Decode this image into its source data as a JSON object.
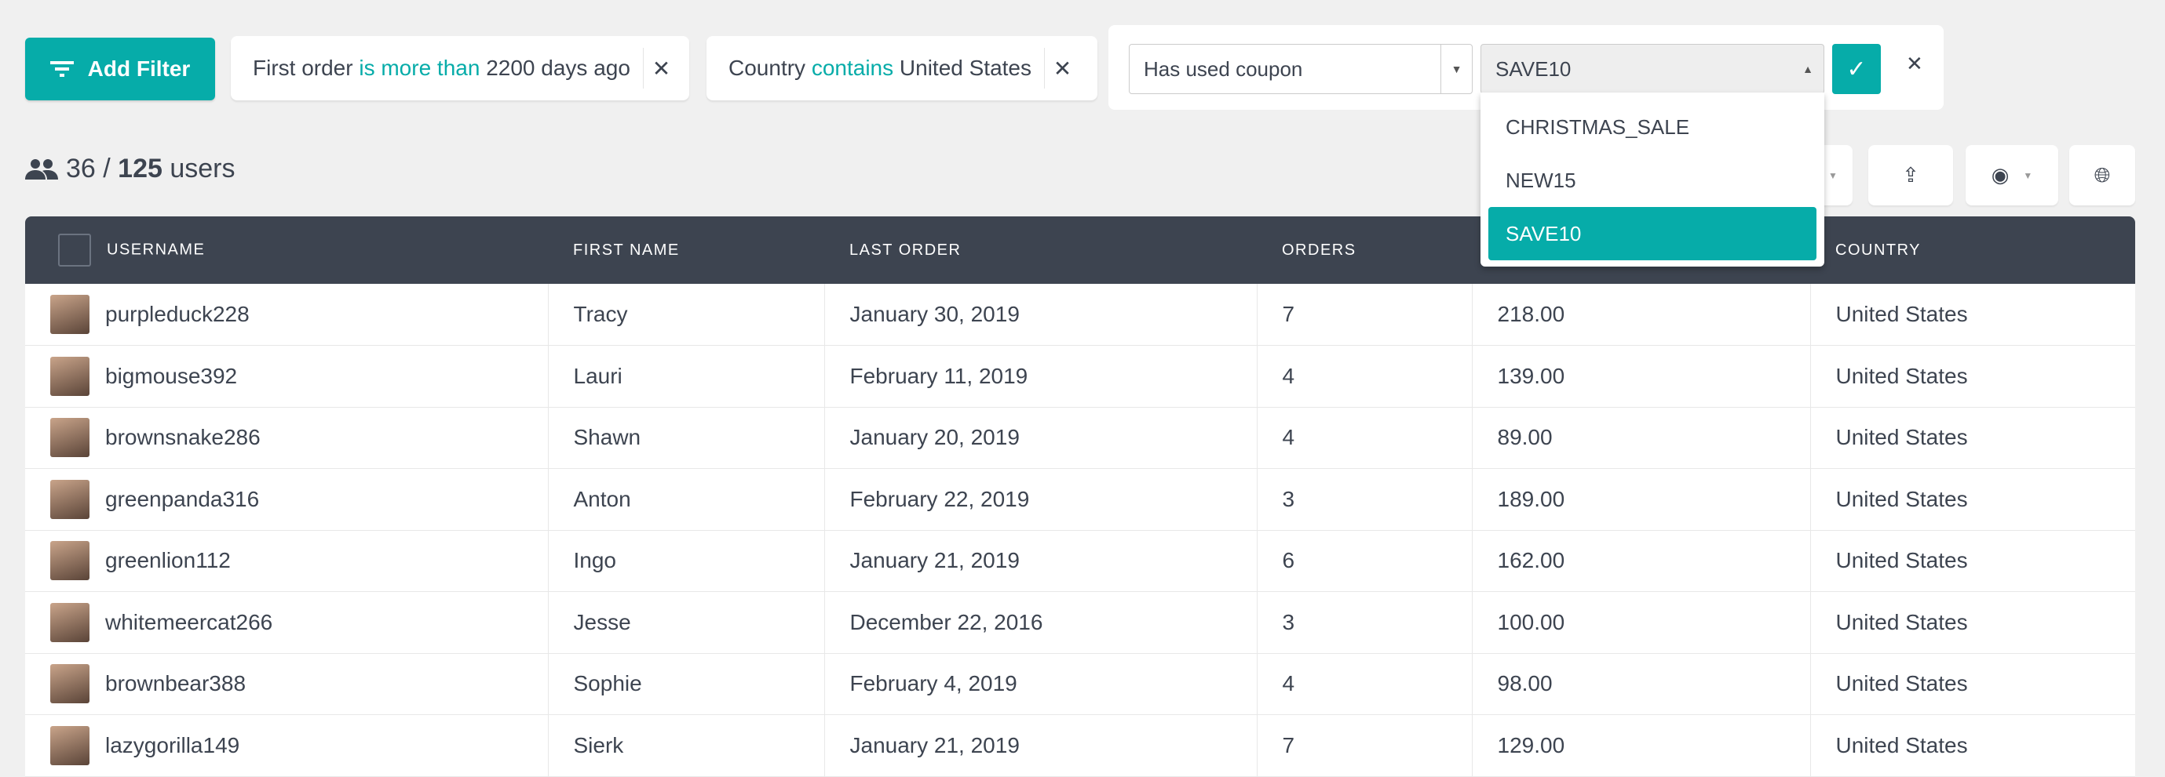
{
  "add_filter": {
    "label": "Add Filter",
    "icon": "filter-icon"
  },
  "filters": [
    {
      "field": "First order",
      "op": "is more than",
      "value": "2200 days ago"
    },
    {
      "field": "Country",
      "op": "contains",
      "value": "United States"
    }
  ],
  "editor": {
    "field": "Has used coupon",
    "value": "SAVE10",
    "options": [
      "CHRISTMAS_SALE",
      "NEW15",
      "SAVE10"
    ],
    "selected": "SAVE10"
  },
  "count": {
    "shown": "36",
    "sep": " / ",
    "total": "125",
    "unit": " users"
  },
  "accent": "#06aca9",
  "header_color": "#3d4450",
  "columns": [
    "USERNAME",
    "FIRST NAME",
    "LAST ORDER",
    "ORDERS",
    "",
    "COUNTRY"
  ],
  "rows": [
    [
      "purpleduck228",
      "Tracy",
      "January 30, 2019",
      "7",
      "218.00",
      "United States"
    ],
    [
      "bigmouse392",
      "Lauri",
      "February 11, 2019",
      "4",
      "139.00",
      "United States"
    ],
    [
      "brownsnake286",
      "Shawn",
      "January 20, 2019",
      "4",
      "89.00",
      "United States"
    ],
    [
      "greenpanda316",
      "Anton",
      "February 22, 2019",
      "3",
      "189.00",
      "United States"
    ],
    [
      "greenlion112",
      "Ingo",
      "January 21, 2019",
      "6",
      "162.00",
      "United States"
    ],
    [
      "whitemeercat266",
      "Jesse",
      "December 22, 2016",
      "3",
      "100.00",
      "United States"
    ],
    [
      "brownbear388",
      "Sophie",
      "February 4, 2019",
      "4",
      "98.00",
      "United States"
    ],
    [
      "lazygorilla149",
      "Sierk",
      "January 21, 2019",
      "7",
      "129.00",
      "United States"
    ]
  ]
}
